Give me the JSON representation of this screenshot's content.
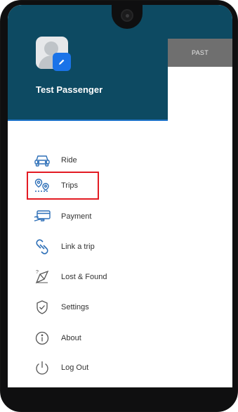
{
  "app": {
    "user_name": "Test Passenger",
    "tabs": {
      "past_label": "PAST"
    }
  },
  "menu": {
    "items": [
      {
        "label": "Ride",
        "icon": "car-icon"
      },
      {
        "label": "Trips",
        "icon": "trips-location-icon",
        "highlighted": true
      },
      {
        "label": "Payment",
        "icon": "payment-card-icon"
      },
      {
        "label": "Link a trip",
        "icon": "link-icon"
      },
      {
        "label": "Lost & Found",
        "icon": "lost-found-icon"
      },
      {
        "label": "Settings",
        "icon": "shield-check-icon"
      },
      {
        "label": "About",
        "icon": "info-icon"
      },
      {
        "label": "Log Out",
        "icon": "power-icon"
      }
    ]
  },
  "colors": {
    "header": "#0d4a62",
    "accent": "#1a73e8",
    "highlight_border": "#e31b23",
    "icon_blue": "#2d6fb7"
  }
}
